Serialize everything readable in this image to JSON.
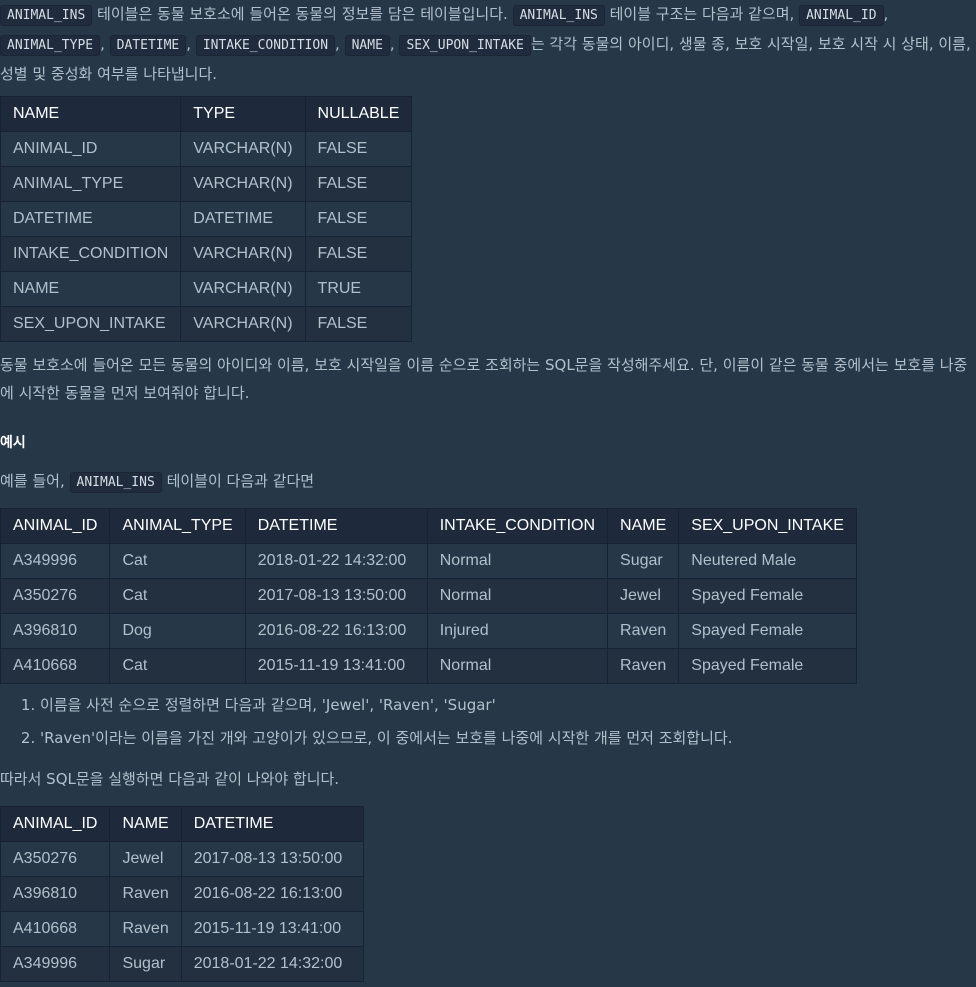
{
  "intro": {
    "code_table": "ANIMAL_INS",
    "t1": " 테이블은 동물 보호소에 들어온 동물의 정보를 담은 테이블입니다. ",
    "code_table2": "ANIMAL_INS",
    "t2": " 테이블 구조는 다음과 같으며, ",
    "c_id": "ANIMAL_ID",
    "sep1": ", ",
    "c_type": "ANIMAL_TYPE",
    "sep2": ", ",
    "c_dt": "DATETIME",
    "sep3": ", ",
    "c_cond": "INTAKE_CONDITION",
    "sep4": ", ",
    "c_name": "NAME",
    "sep5": ", ",
    "c_sex": "SEX_UPON_INTAKE",
    "t3": "는 각각 동물의 아이디, 생물 종, 보호 시작일, 보호 시작 시 상태, 이름, 성별 및 중성화 여부를 나타냅니다."
  },
  "schema": {
    "headers": [
      "NAME",
      "TYPE",
      "NULLABLE"
    ],
    "rows": [
      [
        "ANIMAL_ID",
        "VARCHAR(N)",
        "FALSE"
      ],
      [
        "ANIMAL_TYPE",
        "VARCHAR(N)",
        "FALSE"
      ],
      [
        "DATETIME",
        "DATETIME",
        "FALSE"
      ],
      [
        "INTAKE_CONDITION",
        "VARCHAR(N)",
        "FALSE"
      ],
      [
        "NAME",
        "VARCHAR(N)",
        "TRUE"
      ],
      [
        "SEX_UPON_INTAKE",
        "VARCHAR(N)",
        "FALSE"
      ]
    ]
  },
  "question": "동물 보호소에 들어온 모든 동물의 아이디와 이름, 보호 시작일을 이름 순으로 조회하는 SQL문을 작성해주세요. 단, 이름이 같은 동물 중에서는 보호를 나중에 시작한 동물을 먼저 보여줘야 합니다.",
  "example_heading": "예시",
  "example_intro": {
    "pre": "예를 들어, ",
    "code": "ANIMAL_INS",
    "post": " 테이블이 다음과 같다면"
  },
  "example_table": {
    "headers": [
      "ANIMAL_ID",
      "ANIMAL_TYPE",
      "DATETIME",
      "INTAKE_CONDITION",
      "NAME",
      "SEX_UPON_INTAKE"
    ],
    "rows": [
      [
        "A349996",
        "Cat",
        "2018-01-22 14:32:00",
        "Normal",
        "Sugar",
        "Neutered Male"
      ],
      [
        "A350276",
        "Cat",
        "2017-08-13 13:50:00",
        "Normal",
        "Jewel",
        "Spayed Female"
      ],
      [
        "A396810",
        "Dog",
        "2016-08-22 16:13:00",
        "Injured",
        "Raven",
        "Spayed Female"
      ],
      [
        "A410668",
        "Cat",
        "2015-11-19 13:41:00",
        "Normal",
        "Raven",
        "Spayed Female"
      ]
    ]
  },
  "steps": [
    "이름을 사전 순으로 정렬하면 다음과 같으며, 'Jewel', 'Raven', 'Sugar'",
    "'Raven'이라는 이름을 가진 개와 고양이가 있으므로, 이 중에서는 보호를 나중에 시작한 개를 먼저 조회합니다."
  ],
  "result_intro": "따라서 SQL문을 실행하면 다음과 같이 나와야 합니다.",
  "result_table": {
    "headers": [
      "ANIMAL_ID",
      "NAME",
      "DATETIME"
    ],
    "rows": [
      [
        "A350276",
        "Jewel",
        "2017-08-13 13:50:00"
      ],
      [
        "A396810",
        "Raven",
        "2016-08-22 16:13:00"
      ],
      [
        "A410668",
        "Raven",
        "2015-11-19 13:41:00"
      ],
      [
        "A349996",
        "Sugar",
        "2018-01-22 14:32:00"
      ]
    ]
  }
}
